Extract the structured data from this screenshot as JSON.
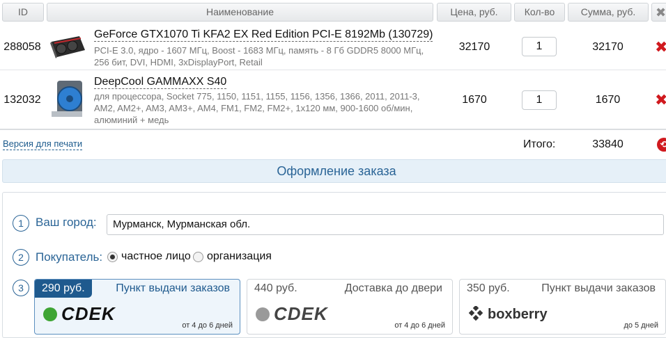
{
  "table": {
    "headers": {
      "id": "ID",
      "name": "Наименование",
      "price": "Цена, руб.",
      "qty": "Кол-во",
      "sum": "Сумма, руб."
    },
    "rows": [
      {
        "id": "288058",
        "name": "GeForce GTX1070 Ti KFA2 EX Red Edition PCI-E 8192Mb (130729)",
        "desc": "PCI-E 3.0, ядро - 1607 МГц, Boost - 1683 МГц, память - 8 Гб GDDR5 8000 МГц, 256 бит, DVI, HDMI, 3xDisplayPort, Retail",
        "price": "32170",
        "qty": "1",
        "sum": "32170"
      },
      {
        "id": "132032",
        "name": "DeepCool GAMMAXX S40",
        "desc": "для процессора, Socket 775, 1150, 1151, 1155, 1156, 1356, 1366, 2011, 2011-3, AM2, AM2+, AM3, AM3+, AM4, FM1, FM2, FM2+, 1x120 мм, 900-1600 об/мин, алюминий + медь",
        "price": "1670",
        "qty": "1",
        "sum": "1670"
      }
    ]
  },
  "footer": {
    "print_link": "Версия для печати",
    "total_label": "Итого:",
    "total_value": "33840"
  },
  "order": {
    "title": "Оформление заказа",
    "steps": {
      "city": {
        "num": "1",
        "label": "Ваш город:",
        "value": "Мурманск, Мурманская обл."
      },
      "buyer": {
        "num": "2",
        "label": "Покупатель:",
        "options": [
          "частное лицо",
          "организация"
        ],
        "selected": "частное лицо"
      },
      "delivery": {
        "num": "3"
      }
    },
    "delivery_options": [
      {
        "price": "290 руб.",
        "title": "Пункт выдачи заказов",
        "logo": "CDEK",
        "days": "от 4 до 6 дней",
        "selected": true
      },
      {
        "price": "440 руб.",
        "title": "Доставка до двери",
        "logo": "CDEK",
        "days": "от 4 до 6 дней",
        "selected": false
      },
      {
        "price": "350 руб.",
        "title": "Пункт выдачи заказов",
        "logo": "boxberry",
        "days": "до 5 дней",
        "selected": false
      }
    ]
  },
  "colors": {
    "accent": "#2a6496",
    "selected_card": "#1f5a8e",
    "delete": "#d0191e",
    "cdek_green": "#3fa535"
  },
  "icons": {
    "header_close": "close-x-icon",
    "row_delete": "delete-x-icon",
    "total_action": "round-arrow-icon"
  }
}
